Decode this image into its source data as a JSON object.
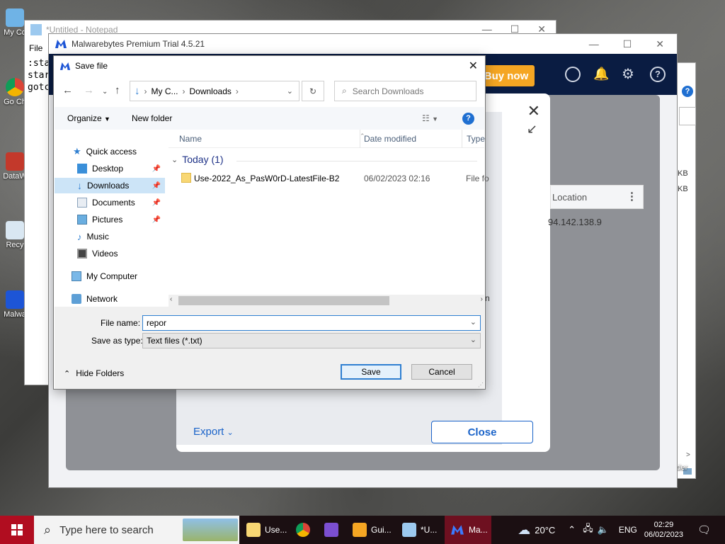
{
  "desktop": {
    "icons": [
      {
        "label": "My Co",
        "icon": "computer-icon"
      },
      {
        "label": "Go Ch",
        "icon": "chrome-icon"
      },
      {
        "label": "DataW",
        "icon": "shortcut-icon"
      },
      {
        "label": "Recy",
        "icon": "recycle-bin-icon"
      },
      {
        "label": "Malwa",
        "icon": "malwarebytes-icon"
      }
    ]
  },
  "notepad": {
    "title": "*Untitled - Notepad",
    "menu_file": "File",
    "lines": [
      ":sta",
      "star",
      "gotc"
    ]
  },
  "right_window": {
    "kb1": "KB",
    "kb2": "KB",
    "folder": "lder"
  },
  "malwarebytes": {
    "title": "Malwarebytes Premium Trial  4.5.21",
    "buy_now": "Buy now",
    "location_header": "Location",
    "location_value": "94.142.138.9",
    "partial_n": "n",
    "export": "Export",
    "close": "Close"
  },
  "save_dialog": {
    "title": "Save file",
    "breadcrumb": [
      "My C...",
      "Downloads"
    ],
    "search_placeholder": "Search Downloads",
    "organize": "Organize",
    "new_folder": "New folder",
    "nav": {
      "quick_access": "Quick access",
      "items": [
        "Desktop",
        "Downloads",
        "Documents",
        "Pictures",
        "Music",
        "Videos"
      ],
      "my_computer": "My Computer",
      "network": "Network"
    },
    "columns": {
      "name": "Name",
      "date": "Date modified",
      "type": "Type"
    },
    "group": {
      "label": "Today (1)"
    },
    "files": [
      {
        "name": "Use-2022_As_PasW0rD-LatestFile-B2",
        "date": "06/02/2023 02:16",
        "type": "File fo"
      }
    ],
    "file_name_label": "File name:",
    "file_name_value": "repor",
    "save_as_type_label": "Save as type:",
    "save_as_type_value": "Text files (*.txt)",
    "hide_folders": "Hide Folders",
    "save": "Save",
    "cancel": "Cancel"
  },
  "taskbar": {
    "search_placeholder": "Type here to search",
    "apps": [
      {
        "label": "Use...",
        "icon": "folder-icon"
      },
      {
        "label": "",
        "icon": "chrome-icon"
      },
      {
        "label": "",
        "icon": "visual-studio-icon"
      },
      {
        "label": "Gui...",
        "icon": "guide-app-icon"
      },
      {
        "label": "*U...",
        "icon": "notepad-icon"
      },
      {
        "label": "Ma...",
        "icon": "malwarebytes-icon"
      }
    ],
    "weather": "20°C",
    "language": "ENG",
    "time": "02:29",
    "date": "06/02/2023"
  },
  "colors": {
    "accent": "#2f7fd1",
    "mb_navy": "#0a1c42",
    "buy_orange": "#f5a623",
    "taskbar_red": "#b10d20"
  }
}
